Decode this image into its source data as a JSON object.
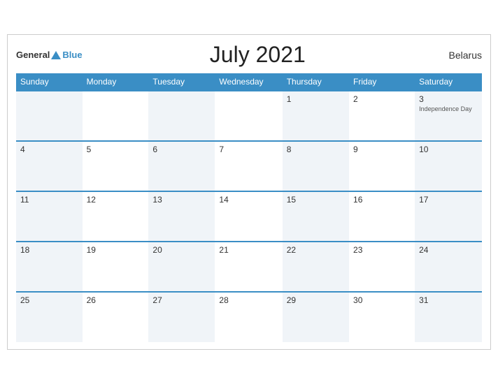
{
  "header": {
    "logo_general": "General",
    "logo_blue": "Blue",
    "title": "July 2021",
    "country": "Belarus"
  },
  "days_of_week": [
    "Sunday",
    "Monday",
    "Tuesday",
    "Wednesday",
    "Thursday",
    "Friday",
    "Saturday"
  ],
  "weeks": [
    [
      {
        "day": "",
        "holiday": ""
      },
      {
        "day": "",
        "holiday": ""
      },
      {
        "day": "",
        "holiday": ""
      },
      {
        "day": "",
        "holiday": ""
      },
      {
        "day": "1",
        "holiday": ""
      },
      {
        "day": "2",
        "holiday": ""
      },
      {
        "day": "3",
        "holiday": "Independence Day"
      }
    ],
    [
      {
        "day": "4",
        "holiday": ""
      },
      {
        "day": "5",
        "holiday": ""
      },
      {
        "day": "6",
        "holiday": ""
      },
      {
        "day": "7",
        "holiday": ""
      },
      {
        "day": "8",
        "holiday": ""
      },
      {
        "day": "9",
        "holiday": ""
      },
      {
        "day": "10",
        "holiday": ""
      }
    ],
    [
      {
        "day": "11",
        "holiday": ""
      },
      {
        "day": "12",
        "holiday": ""
      },
      {
        "day": "13",
        "holiday": ""
      },
      {
        "day": "14",
        "holiday": ""
      },
      {
        "day": "15",
        "holiday": ""
      },
      {
        "day": "16",
        "holiday": ""
      },
      {
        "day": "17",
        "holiday": ""
      }
    ],
    [
      {
        "day": "18",
        "holiday": ""
      },
      {
        "day": "19",
        "holiday": ""
      },
      {
        "day": "20",
        "holiday": ""
      },
      {
        "day": "21",
        "holiday": ""
      },
      {
        "day": "22",
        "holiday": ""
      },
      {
        "day": "23",
        "holiday": ""
      },
      {
        "day": "24",
        "holiday": ""
      }
    ],
    [
      {
        "day": "25",
        "holiday": ""
      },
      {
        "day": "26",
        "holiday": ""
      },
      {
        "day": "27",
        "holiday": ""
      },
      {
        "day": "28",
        "holiday": ""
      },
      {
        "day": "29",
        "holiday": ""
      },
      {
        "day": "30",
        "holiday": ""
      },
      {
        "day": "31",
        "holiday": ""
      }
    ]
  ]
}
